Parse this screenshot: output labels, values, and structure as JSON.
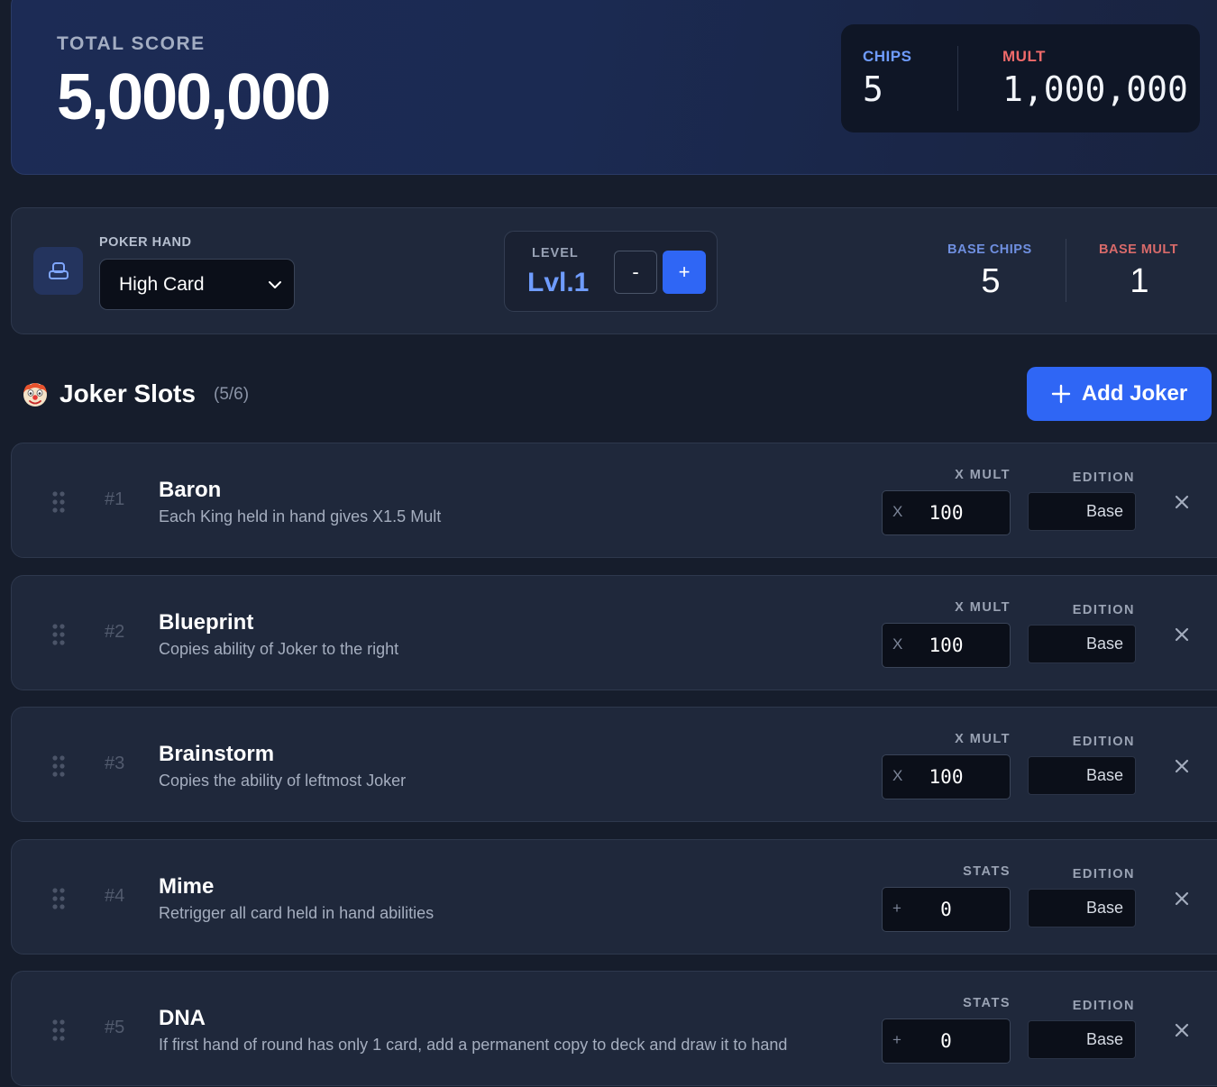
{
  "score": {
    "total_label": "TOTAL SCORE",
    "total_value": "5,000,000",
    "chips_label": "CHIPS",
    "chips_value": "5",
    "mult_label": "MULT",
    "mult_value": "1,000,000"
  },
  "hand": {
    "label": "POKER HAND",
    "selected": "High Card",
    "level_label": "LEVEL",
    "level_value": "Lvl.1",
    "minus": "-",
    "plus": "+",
    "base_chips_label": "BASE CHIPS",
    "base_chips_value": "5",
    "base_mult_label": "BASE MULT",
    "base_mult_value": "1"
  },
  "slots": {
    "title": "Joker Slots",
    "count": "(5/6)",
    "add_label": "Add Joker"
  },
  "jokers": [
    {
      "num": "#1",
      "name": "Baron",
      "desc": "Each King held in hand gives X1.5 Mult",
      "stat_label": "X MULT",
      "prefix": "X",
      "value": "100",
      "edition_label": "EDITION",
      "edition": "Base"
    },
    {
      "num": "#2",
      "name": "Blueprint",
      "desc": "Copies ability of Joker to the right",
      "stat_label": "X MULT",
      "prefix": "X",
      "value": "100",
      "edition_label": "EDITION",
      "edition": "Base"
    },
    {
      "num": "#3",
      "name": "Brainstorm",
      "desc": "Copies the ability of leftmost Joker",
      "stat_label": "X MULT",
      "prefix": "X",
      "value": "100",
      "edition_label": "EDITION",
      "edition": "Base"
    },
    {
      "num": "#4",
      "name": "Mime",
      "desc": "Retrigger all card held in hand abilities",
      "stat_label": "STATS",
      "prefix": "+",
      "value": "0",
      "edition_label": "EDITION",
      "edition": "Base"
    },
    {
      "num": "#5",
      "name": "DNA",
      "desc": "If first hand of round has only 1 card, add a permanent copy to deck and draw it to hand",
      "stat_label": "STATS",
      "prefix": "+",
      "value": "0",
      "edition_label": "EDITION",
      "edition": "Base"
    }
  ],
  "colors": {
    "accent": "#2f66f5",
    "chips": "#6f9cff",
    "mult": "#f06a6a",
    "base_chips": "#6f8fe0",
    "base_mult": "#d86a6a"
  },
  "icons": {
    "hand": "hand-cards-icon",
    "select": "chevron-down-icon",
    "slots": "clown-face-icon",
    "add": "plus-icon",
    "drag": "drag-handle-icon",
    "remove": "close-icon"
  }
}
